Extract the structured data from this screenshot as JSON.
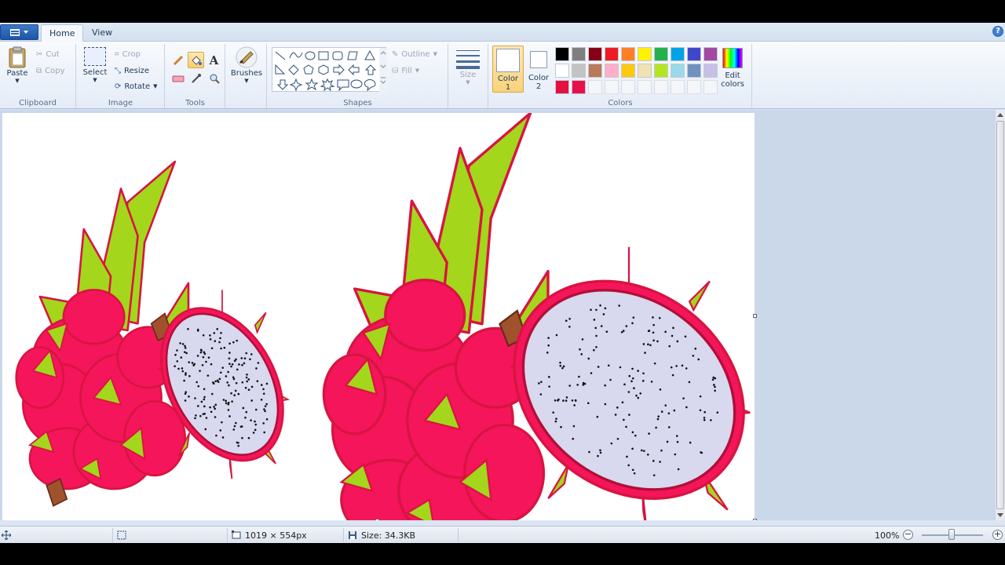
{
  "tabs": [
    {
      "label": "Home",
      "active": true
    },
    {
      "label": "View",
      "active": false
    }
  ],
  "help_glyph": "?",
  "clipboard": {
    "group_label": "Clipboard",
    "paste": "Paste",
    "cut": "Cut",
    "copy": "Copy"
  },
  "image": {
    "group_label": "Image",
    "select": "Select",
    "crop": "Crop",
    "resize": "Resize",
    "rotate": "Rotate"
  },
  "tools": {
    "group_label": "Tools",
    "active_tool": "fill-icon"
  },
  "brushes": {
    "label": "Brushes"
  },
  "shapes": {
    "group_label": "Shapes",
    "outline": "Outline",
    "fill": "Fill"
  },
  "size": {
    "label": "Size"
  },
  "colors": {
    "group_label": "Colors",
    "color1_line1": "Color",
    "color1_line2": "1",
    "color2_line1": "Color",
    "color2_line2": "2",
    "edit_line1": "Edit",
    "edit_line2": "colors",
    "color1_value": "#ffffff",
    "color2_value": "#ffffff",
    "palette": [
      "#000000",
      "#7f7f7f",
      "#880015",
      "#ed1c24",
      "#ff7f27",
      "#fff200",
      "#22b14c",
      "#00a2e8",
      "#3f48cc",
      "#a349a4",
      "#ffffff",
      "#c3c3c3",
      "#b97a57",
      "#ffaec9",
      "#ffc90e",
      "#efe4b0",
      "#b5e61d",
      "#99d9ea",
      "#7092be",
      "#c8bfe7",
      "#e4103f",
      "#e8104a",
      "",
      "",
      "",
      "",
      "",
      "",
      "",
      ""
    ]
  },
  "status": {
    "dimensions": "1019 × 554px",
    "size": "Size: 34.3KB",
    "zoom": "100%",
    "zoom_minus": "−",
    "zoom_plus": "+"
  },
  "drawing": {
    "skin_color": "#f5155a",
    "outline_color": "#d71441",
    "leaf_color": "#a4d61c",
    "flesh_color": "#d8d8ef",
    "seed_color": "#111111",
    "stem_color": "#a0522d"
  }
}
